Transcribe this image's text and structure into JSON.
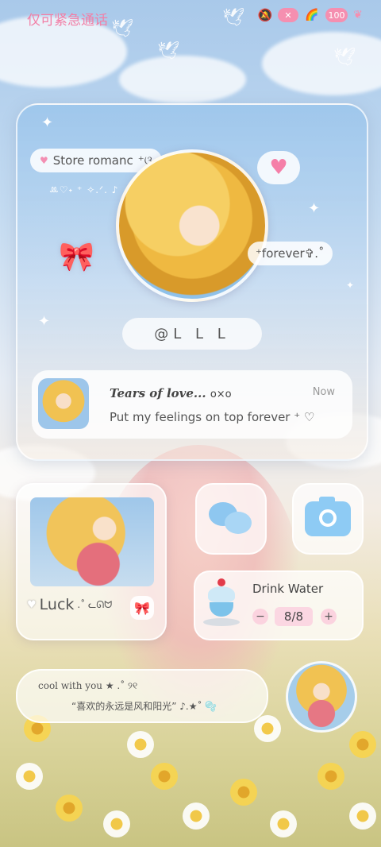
{
  "status_bar": {
    "carrier": "仅可紧急通话",
    "battery": "100",
    "icons": [
      "mute-icon",
      "battery-saver-icon",
      "rainbow-icon",
      "battery-icon",
      "leaf-icon"
    ]
  },
  "profile_card": {
    "store_pill": "Store romanc",
    "store_suffix": "⁺ଓ",
    "deco_text": "ꔛ♡˖ ⁺ ✧.ᐟ. ♪",
    "forever_pill": "⁺forever✞.˚",
    "handle": "@L L L",
    "notification": {
      "title": "Tears of love...",
      "title_suffix": "o×o",
      "time": "Now",
      "body": "Put my feelings on top forever ⁺ ♡"
    }
  },
  "photo_widget": {
    "label": "Luck",
    "label_suffix": ".˚ ᓚᘏᗢ"
  },
  "apps": {
    "wechat": "wechat-icon",
    "camera": "camera-icon"
  },
  "water_widget": {
    "title": "Drink Water",
    "minus": "−",
    "count": "8/8",
    "plus": "+"
  },
  "quote_widget": {
    "line1": "cool with you ★ .˚ ୨୧",
    "line2": "“喜欢的永远是风和阳光” ♪.★˚ 🫧"
  },
  "colors": {
    "accent_pink": "#f27fa6",
    "accent_blue": "#8ec7f0"
  }
}
